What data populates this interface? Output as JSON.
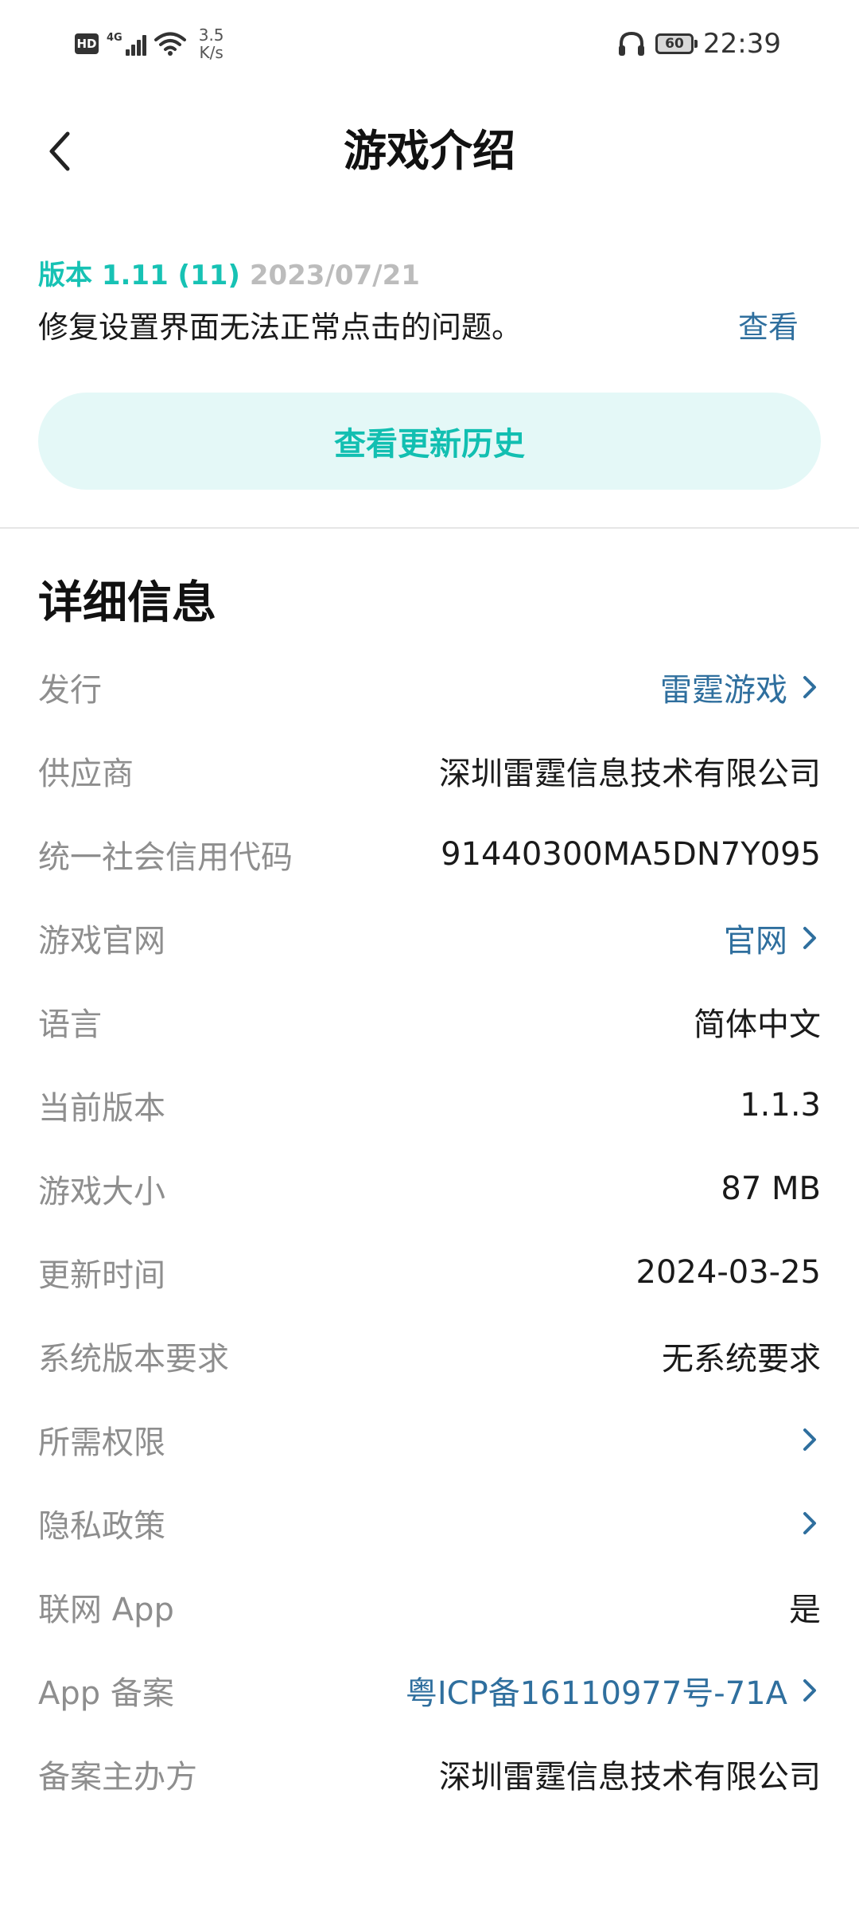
{
  "status_bar": {
    "network_type": "4G",
    "hd_badge": "HD",
    "speed_value": "3.5",
    "speed_unit": "K/s",
    "battery": "60",
    "time": "22:39"
  },
  "header": {
    "title": "游戏介绍"
  },
  "version": {
    "label": "版本 1.11 (11)",
    "date": "2023/07/21",
    "note": "修复设置界面无法正常点击的问题。",
    "view_label": "查看",
    "history_button": "查看更新历史"
  },
  "details": {
    "title": "详细信息",
    "rows": [
      {
        "label": "发行",
        "value": "雷霆游戏",
        "link": true,
        "chevron": true
      },
      {
        "label": "供应商",
        "value": "深圳雷霆信息技术有限公司",
        "link": false,
        "chevron": false
      },
      {
        "label": "统一社会信用代码",
        "value": "91440300MA5DN7Y095",
        "link": false,
        "chevron": false
      },
      {
        "label": "游戏官网",
        "value": "官网",
        "link": true,
        "chevron": true
      },
      {
        "label": "语言",
        "value": "简体中文",
        "link": false,
        "chevron": false
      },
      {
        "label": "当前版本",
        "value": "1.1.3",
        "link": false,
        "chevron": false
      },
      {
        "label": "游戏大小",
        "value": "87 MB",
        "link": false,
        "chevron": false
      },
      {
        "label": "更新时间",
        "value": "2024-03-25",
        "link": false,
        "chevron": false
      },
      {
        "label": "系统版本要求",
        "value": "无系统要求",
        "link": false,
        "chevron": false
      },
      {
        "label": "所需权限",
        "value": "",
        "link": true,
        "chevron": true
      },
      {
        "label": "隐私政策",
        "value": "",
        "link": true,
        "chevron": true
      },
      {
        "label": "联网 App",
        "value": "是",
        "link": false,
        "chevron": false
      },
      {
        "label": "App 备案",
        "value": "粤ICP备16110977号-71A",
        "link": true,
        "chevron": true
      },
      {
        "label": "备案主办方",
        "value": "深圳雷霆信息技术有限公司",
        "link": false,
        "chevron": false
      }
    ]
  },
  "colors": {
    "accent": "#17c2b4",
    "link": "#2f6f9e",
    "label": "#8e8e8e",
    "history_bg": "#e4f8f7"
  }
}
